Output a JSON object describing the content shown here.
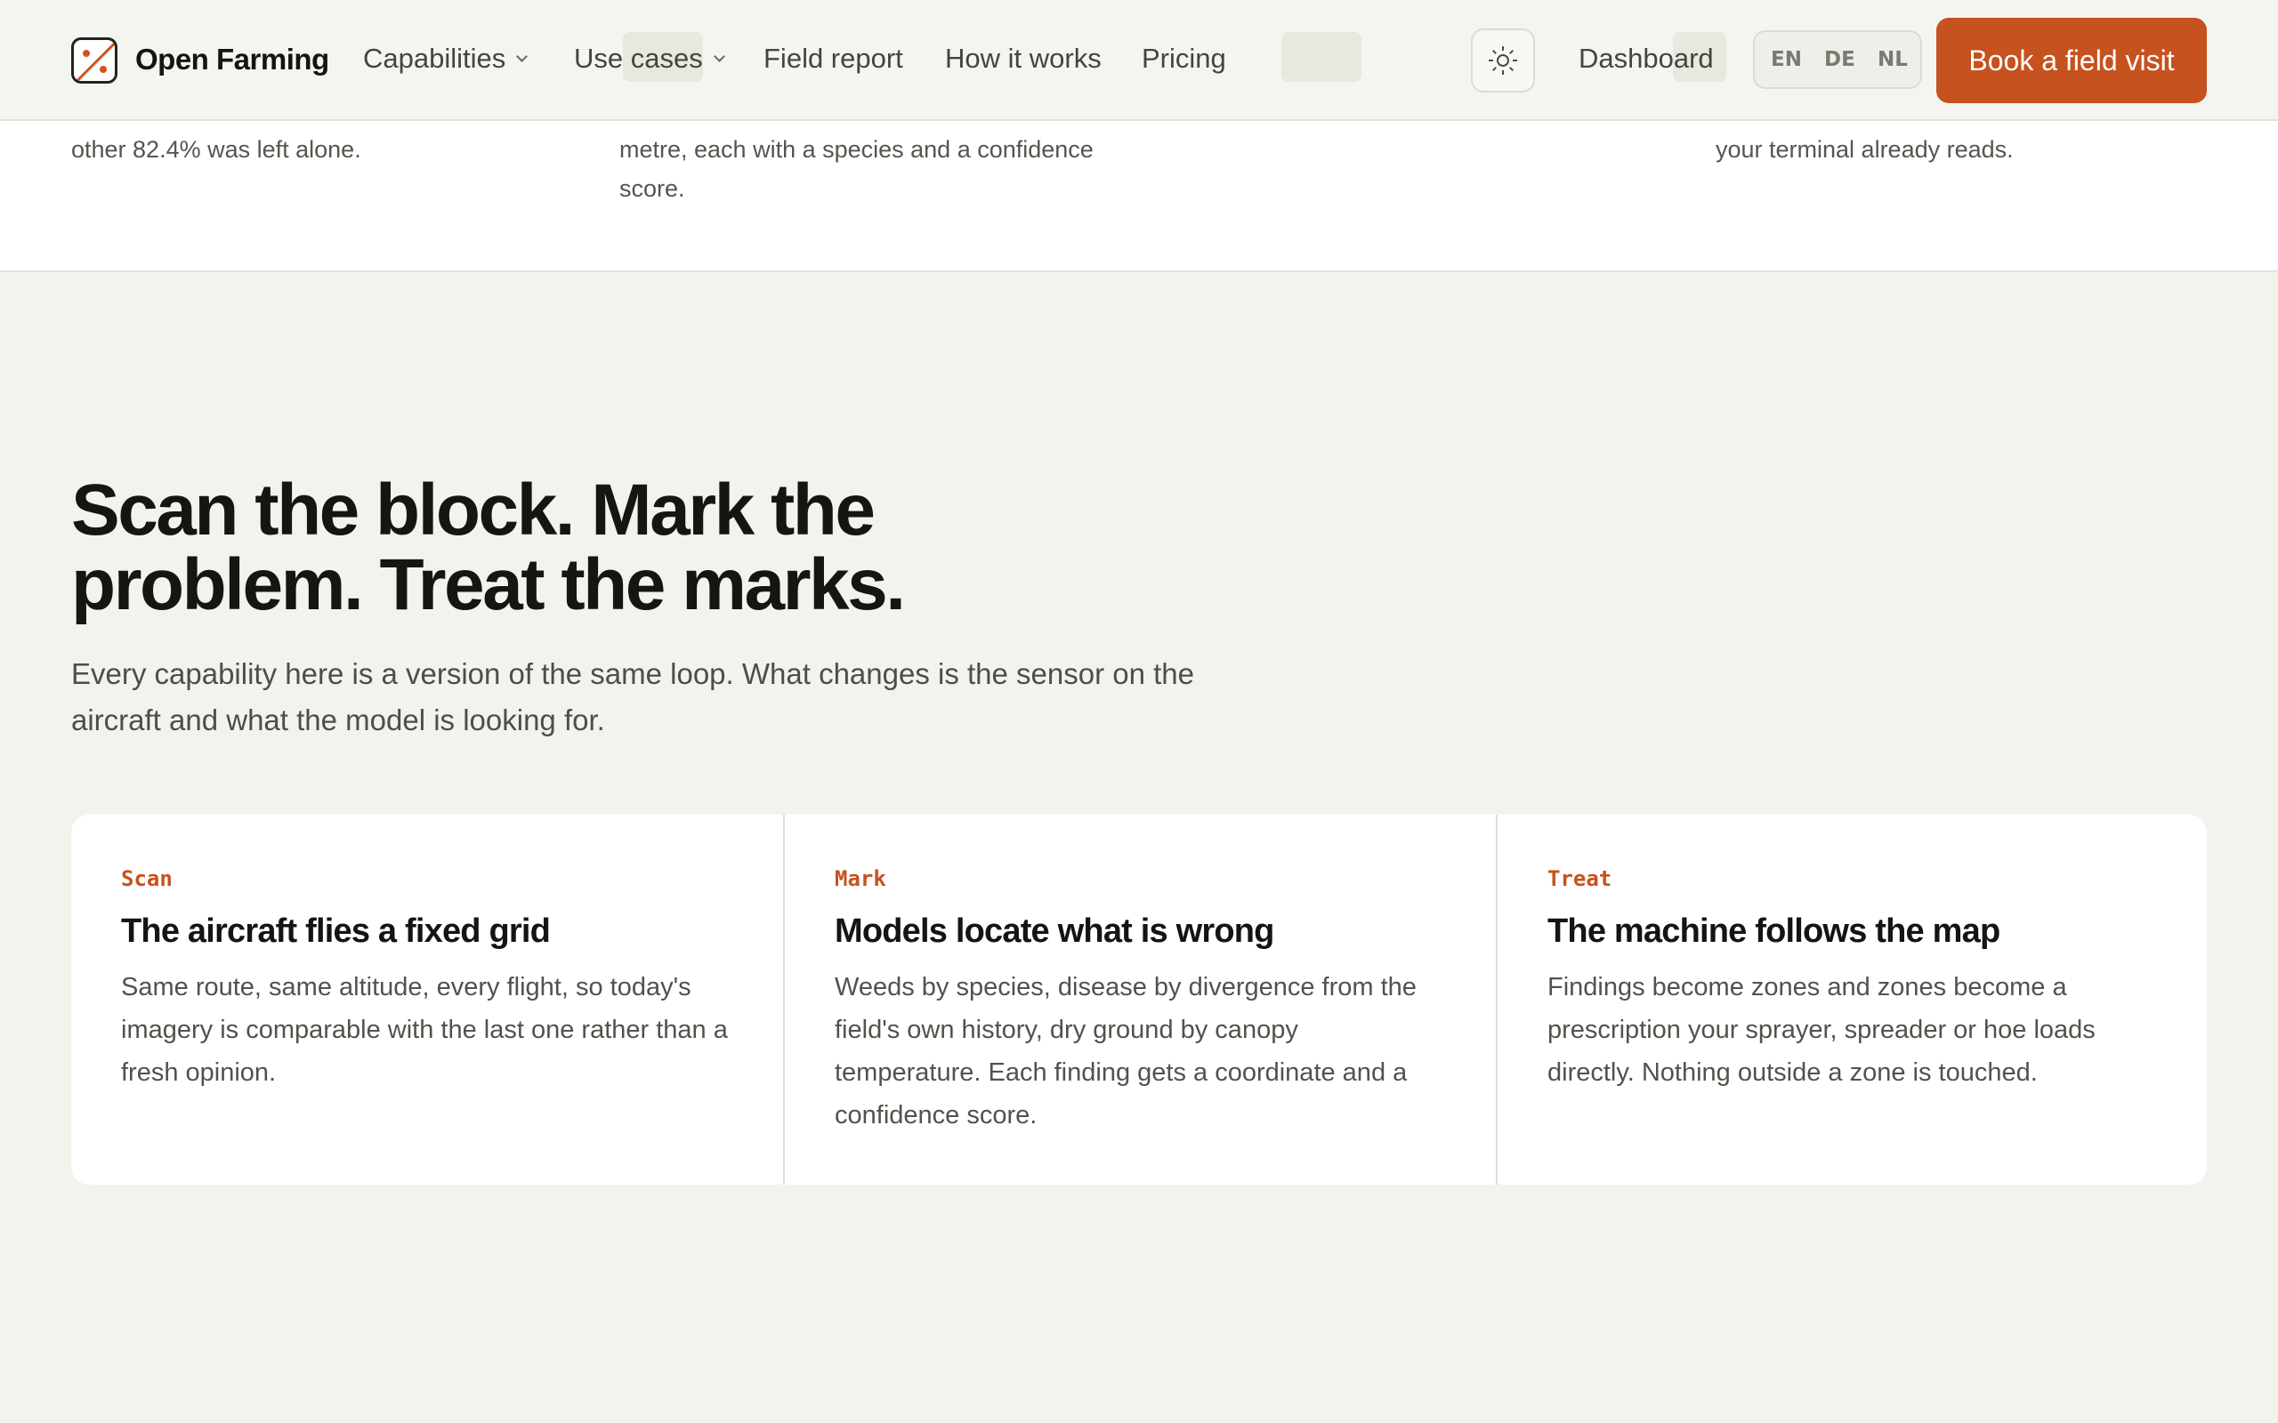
{
  "stats": [
    {
      "text": "other 82.4% was left alone."
    },
    {
      "text": "metre, each with a species and a confidence score."
    },
    {
      "text": "your terminal already reads."
    }
  ],
  "nav": {
    "brand": "Open Farming",
    "links": [
      {
        "label": "Capabilities",
        "dropdown": true
      },
      {
        "label": "Use cases",
        "dropdown": true
      },
      {
        "label": "Field report"
      },
      {
        "label": "How it works"
      },
      {
        "label": "Pricing"
      }
    ],
    "theme_icon": "sun-icon",
    "dashboard": "Dashboard",
    "languages": [
      "EN",
      "DE",
      "NL"
    ],
    "cta": "Book a field visit"
  },
  "section": {
    "heading": "Scan the block. Mark the problem. Treat the marks.",
    "lede": "Every capability here is a version of the same loop. What changes is the sensor on the aircraft and what the model is looking for.",
    "steps": [
      {
        "eyebrow": "Scan",
        "title": "The aircraft flies a fixed grid",
        "body": "Same route, same altitude, every flight, so today's imagery is comparable with the last one rather than a fresh opinion."
      },
      {
        "eyebrow": "Mark",
        "title": "Models locate what is wrong",
        "body": "Weeds by species, disease by divergence from the field's own history, dry ground by canopy temperature. Each finding gets a coordinate and a confidence score."
      },
      {
        "eyebrow": "Treat",
        "title": "The machine follows the map",
        "body": "Findings become zones and zones become a prescription your sprayer, spreader or hoe loads directly. Nothing outside a zone is touched."
      }
    ]
  },
  "colors": {
    "accent": "#c6521f",
    "background": "#f3f3ee",
    "card": "#ffffff"
  }
}
